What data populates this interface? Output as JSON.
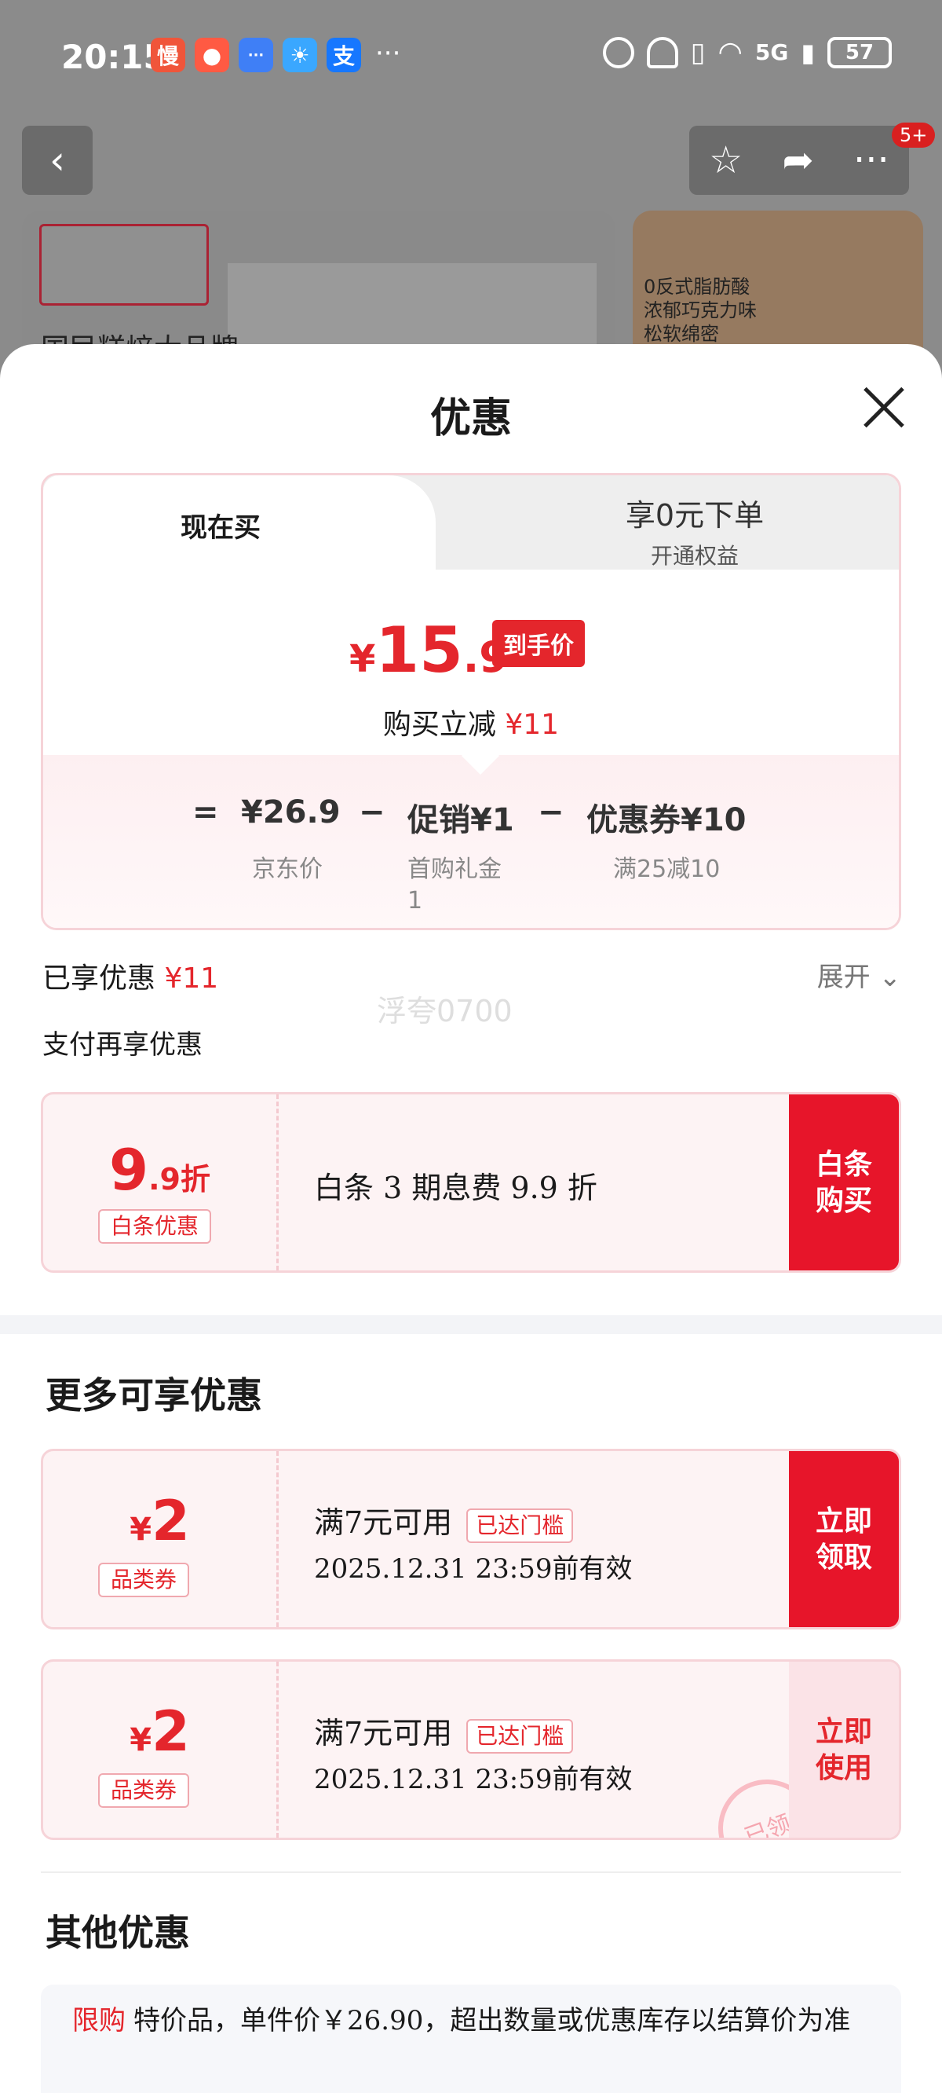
{
  "status_bar": {
    "time": "20:15",
    "app_icons": [
      {
        "icon": "man-app-icon",
        "label": "慢",
        "color": "#f0553a"
      },
      {
        "icon": "jd-app-icon",
        "label": "",
        "color": "#ff5a43"
      },
      {
        "icon": "message-app-icon",
        "label": "···",
        "color": "#3f7ff6"
      },
      {
        "icon": "weather-app-icon",
        "label": "",
        "color": "#3aa7ff"
      },
      {
        "icon": "alipay-app-icon",
        "label": "支",
        "color": "#1677ff"
      }
    ],
    "more": "···",
    "network": "5G",
    "battery": "57"
  },
  "background": {
    "nav_badge": "5+",
    "banner_text": "国民糕焙大品牌",
    "side_text": "0反式脂肪酸 浓郁巧克力味 松软绵密"
  },
  "sheet": {
    "title": "优惠",
    "tabs": {
      "buy_now": "现在买",
      "zero_order": "享0元下单",
      "zero_order_sub": "开通权益"
    },
    "price": {
      "currency": "¥",
      "integer": "15",
      "decimal": ".9",
      "tag": "到手价",
      "reduce_label": "购买立减",
      "reduce_value": "¥11"
    },
    "calc": {
      "equals": "=",
      "base": "¥26.9",
      "base_label": "京东价",
      "minus1": "−",
      "promo": "促销¥1",
      "promo_label": "首购礼金",
      "promo_label2": "1",
      "minus2": "−",
      "coupon": "优惠券¥10",
      "coupon_label": "满25减10"
    },
    "enjoyed_label": "已享优惠",
    "enjoyed_value": "¥11",
    "expand": "展开",
    "watermark": "浮夸0700",
    "pay_more": "支付再享优惠",
    "baitiao": {
      "amount_int": "9",
      "amount_suffix": ".9折",
      "tag": "白条优惠",
      "text": "白条 3 期息费 9.9 折",
      "button": "白条\n购买"
    },
    "more_title": "更多可享优惠",
    "coupons": [
      {
        "currency": "¥",
        "amount": "2",
        "tag": "品类券",
        "text": "满7元可用",
        "reach": "已达门槛",
        "date": "2025.12.31 23:59前有效",
        "button": "立即\n领取"
      },
      {
        "currency": "¥",
        "amount": "2",
        "tag": "品类券",
        "text": "满7元可用",
        "reach": "已达门槛",
        "date": "2025.12.31 23:59前有效",
        "button": "立即\n使用",
        "stamp": "已领"
      }
    ],
    "other_title": "其他优惠",
    "limit": {
      "tag": "限购",
      "text": "特价品，单件价￥26.90，超出数量或优惠库存以结算价为准"
    }
  }
}
